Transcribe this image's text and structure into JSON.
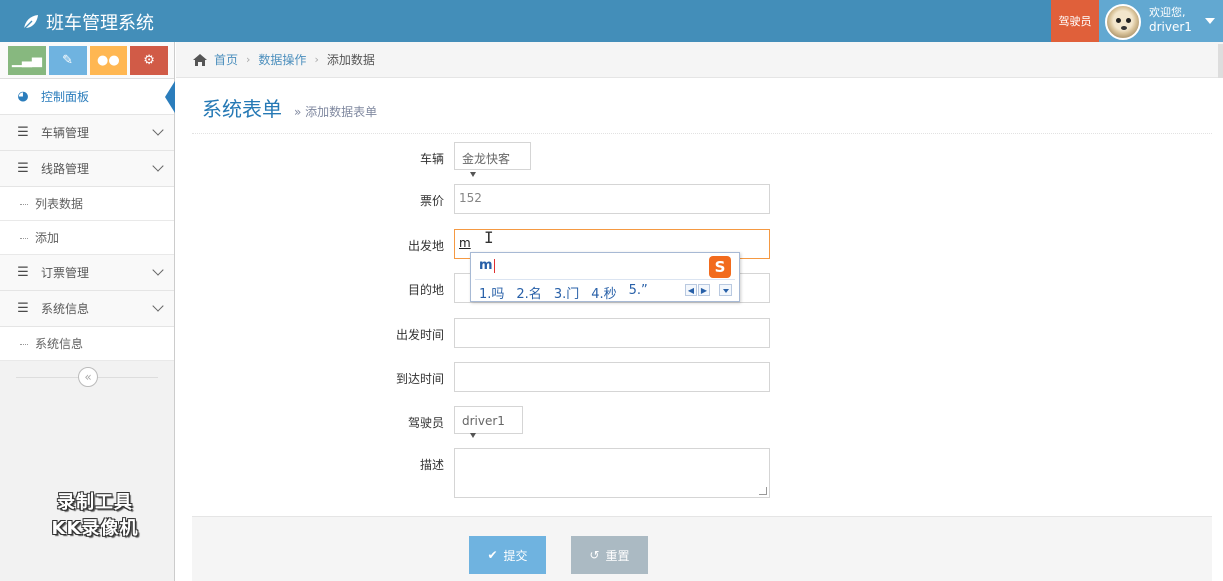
{
  "app": {
    "title": "班车管理系统",
    "role_badge": "驾驶员",
    "welcome": "欢迎您,",
    "username": "driver1"
  },
  "shortcuts": [
    {
      "icon": "signal-icon",
      "color": "#87b87f"
    },
    {
      "icon": "pencil-icon",
      "color": "#6fb3e0"
    },
    {
      "icon": "users-icon",
      "color": "#ffb752"
    },
    {
      "icon": "cogs-icon",
      "color": "#d15b47"
    }
  ],
  "sidebar": {
    "dashboard": "控制面板",
    "vehicle_mgmt": "车辆管理",
    "route_mgmt": "线路管理",
    "route_sub": [
      "列表数据",
      "添加"
    ],
    "ticket_mgmt": "订票管理",
    "system_info": "系统信息",
    "system_sub": [
      "系统信息"
    ]
  },
  "breadcrumb": {
    "home": "首页",
    "section": "数据操作",
    "current": "添加数据"
  },
  "page": {
    "title": "系统表单",
    "subtitle": "» 添加数据表单"
  },
  "form": {
    "vehicle": {
      "label": "车辆",
      "value": "金龙快客"
    },
    "price": {
      "label": "票价",
      "value": "152"
    },
    "departure": {
      "label": "出发地",
      "value": "m"
    },
    "destination": {
      "label": "目的地",
      "value": ""
    },
    "depart_time": {
      "label": "出发时间",
      "value": ""
    },
    "arrive_time": {
      "label": "到达时间",
      "value": ""
    },
    "driver": {
      "label": "驾驶员",
      "value": "driver1"
    },
    "description": {
      "label": "描述",
      "value": ""
    }
  },
  "ime": {
    "composition": "m",
    "logo": "S",
    "candidates": [
      "1.吗",
      "2.名",
      "3.门",
      "4.秒",
      "5.”"
    ]
  },
  "buttons": {
    "submit": "提交",
    "reset": "重置"
  },
  "watermark": {
    "line1": "录制工具",
    "line2": "KK录像机"
  },
  "colors": {
    "navbar": "#438eb9",
    "accent": "#2679b5",
    "badge": "#e0603a",
    "submit": "#6fb3e0",
    "reset": "#abbac3",
    "focus": "#f59942"
  }
}
